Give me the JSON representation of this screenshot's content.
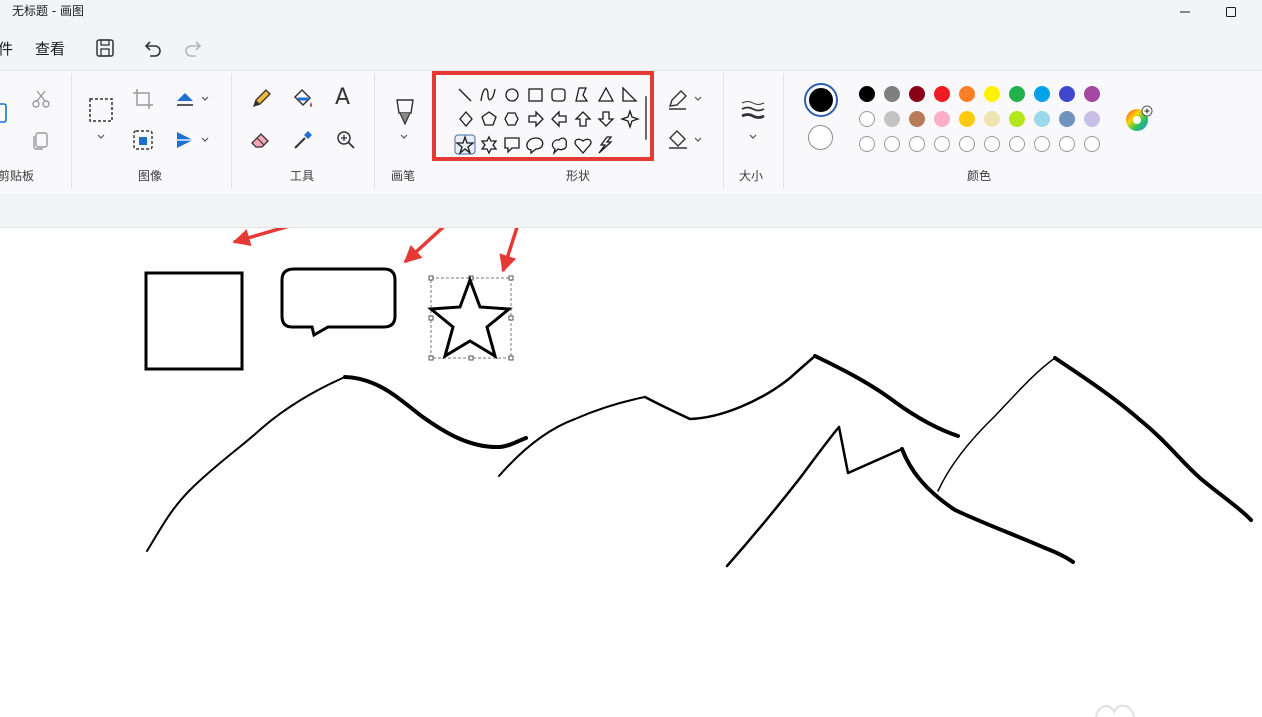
{
  "window": {
    "title": "无标题 - 画图"
  },
  "menu": {
    "file_partial": "件",
    "view": "查看"
  },
  "groups": {
    "clipboard": "剪贴板",
    "image": "图像",
    "tools": "工具",
    "brushes": "画笔",
    "shapes": "形状",
    "size": "大小",
    "colors": "颜色"
  },
  "tools": {
    "text_glyph": "A"
  },
  "colors": {
    "accent_highlight": "#e53935",
    "primary_color": "#000000",
    "secondary_color": "#ffffff",
    "palette_row1": [
      "#000000",
      "#7f7f7f",
      "#880015",
      "#ed1c24",
      "#ff7f27",
      "#fff200",
      "#22b14c",
      "#00a2e8",
      "#3f48cc",
      "#a349a4"
    ],
    "palette_row2": [
      "#ffffff",
      "#c3c3c3",
      "#b97a57",
      "#ffaec9",
      "#ffc90e",
      "#efe4b0",
      "#b5e61d",
      "#99d9ea",
      "#7092be",
      "#c8bfe7"
    ],
    "palette_row3_count": 10
  },
  "shapes_grid": [
    [
      "line",
      "curve",
      "oval",
      "rectangle",
      "rounded-rectangle",
      "polygon",
      "triangle",
      "right-triangle"
    ],
    [
      "diamond",
      "pentagon",
      "hexagon",
      "right-arrow",
      "left-arrow",
      "up-arrow",
      "down-arrow",
      "four-point-star"
    ],
    [
      "five-point-star",
      "six-point-star",
      "rectangular-callout",
      "oval-callout",
      "cloud-callout",
      "heart",
      "lightning"
    ]
  ],
  "selected_shape": "five-point-star"
}
